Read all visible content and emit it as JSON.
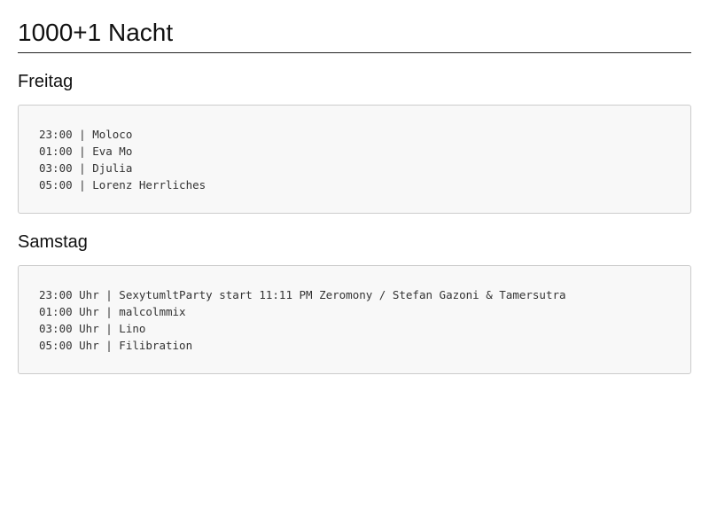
{
  "page": {
    "title": "1000+1 Nacht"
  },
  "days": [
    {
      "name": "Freitag",
      "lines": [
        "23:00 | Moloco",
        "01:00 | Eva Mo",
        "03:00 | Djulia",
        "05:00 | Lorenz Herrliches"
      ]
    },
    {
      "name": "Samstag",
      "lines": [
        "23:00 Uhr | SexytumltParty start 11:11 PM Zeromony / Stefan Gazoni & Tamersutra",
        "01:00 Uhr | malcolmmix",
        "03:00 Uhr | Lino",
        "05:00 Uhr | Filibration"
      ]
    }
  ]
}
